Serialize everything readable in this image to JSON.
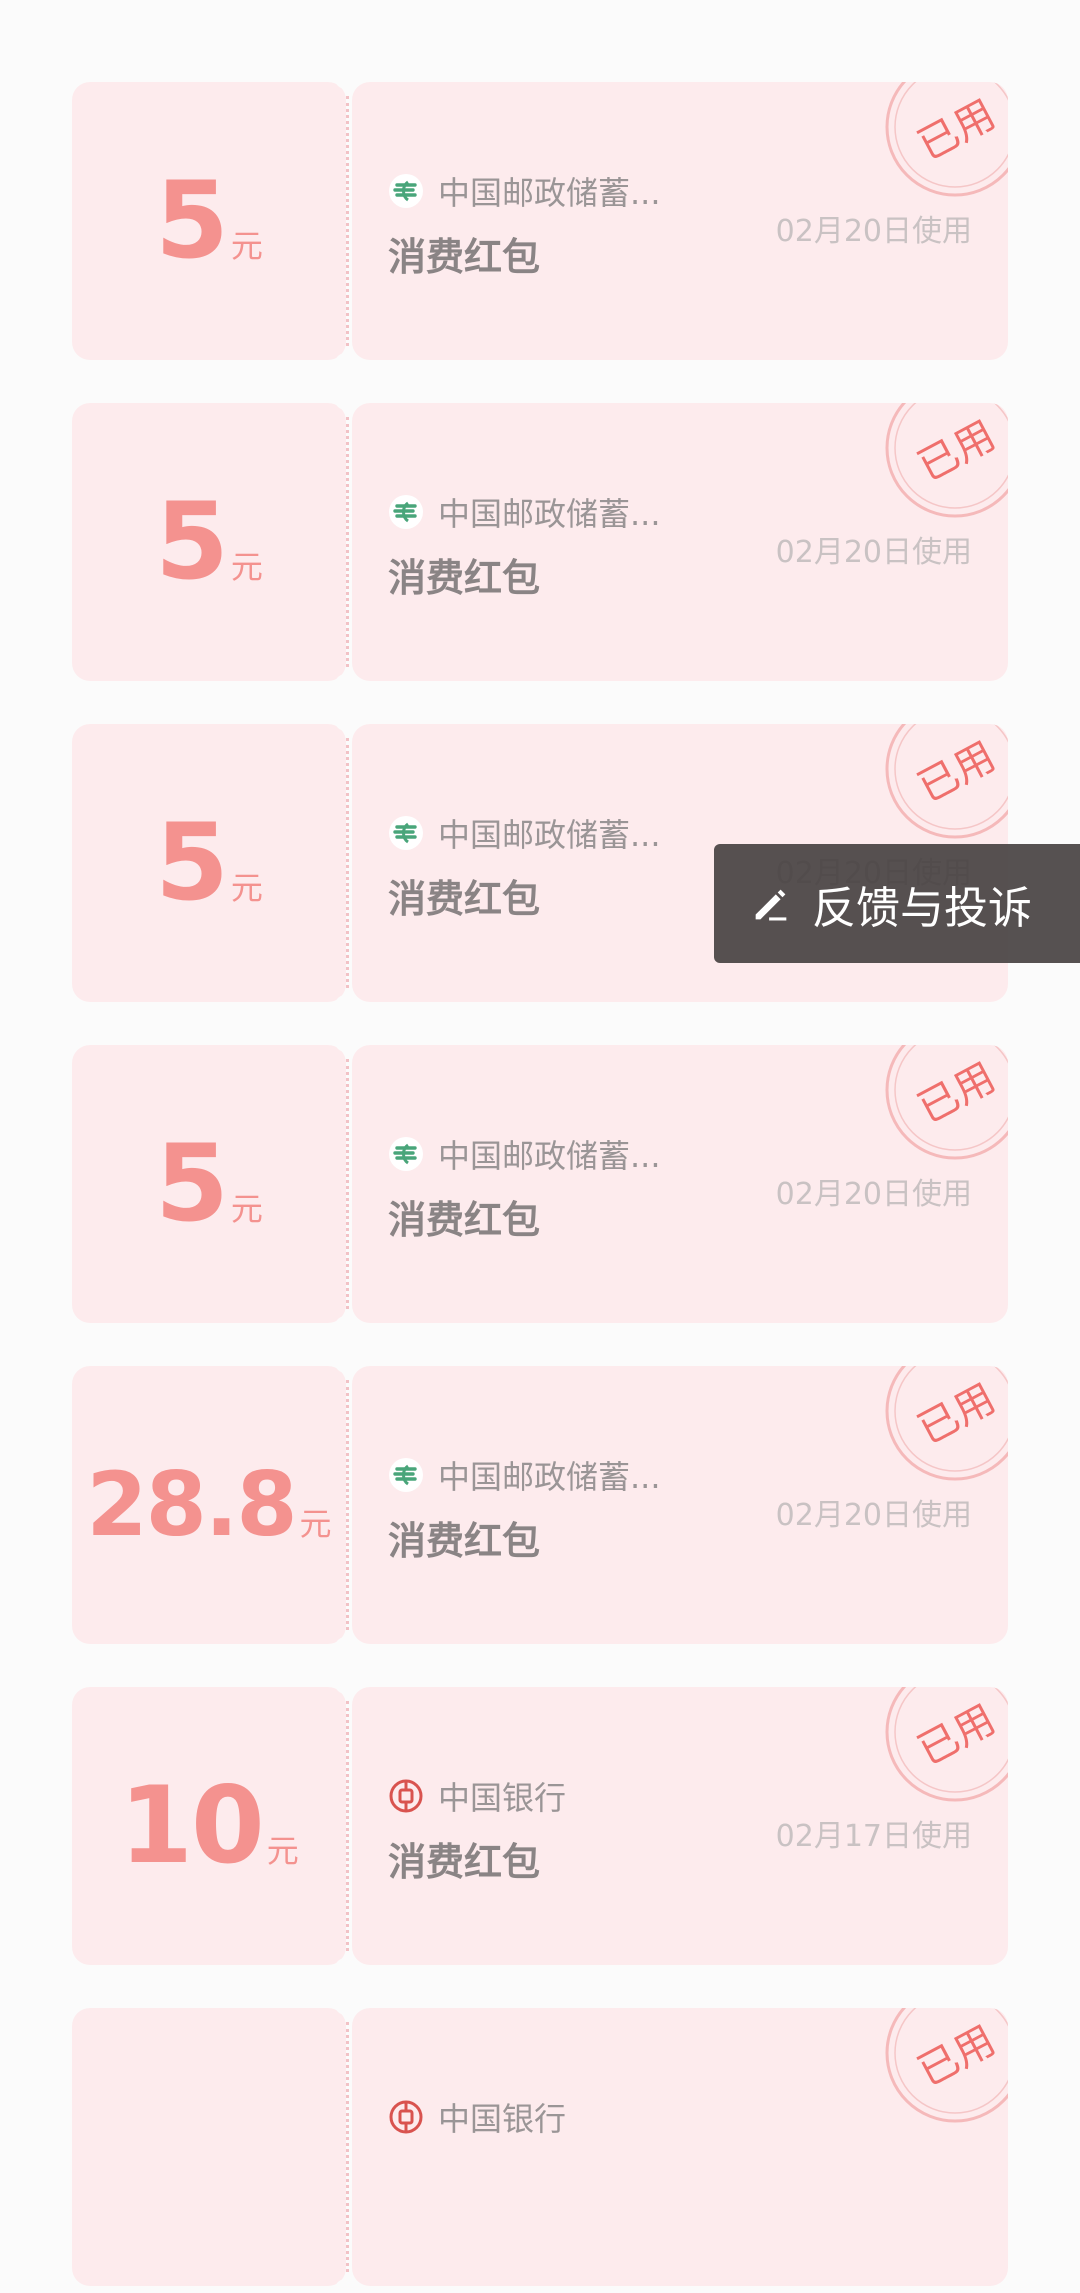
{
  "coupons": [
    {
      "amount": "5",
      "unit": "元",
      "bank": "中国邮政储蓄...",
      "bank_logo": "postal-savings-icon",
      "title": "消费红包",
      "date": "02月20日使用",
      "stamp": "已用"
    },
    {
      "amount": "5",
      "unit": "元",
      "bank": "中国邮政储蓄...",
      "bank_logo": "postal-savings-icon",
      "title": "消费红包",
      "date": "02月20日使用",
      "stamp": "已用"
    },
    {
      "amount": "5",
      "unit": "元",
      "bank": "中国邮政储蓄...",
      "bank_logo": "postal-savings-icon",
      "title": "消费红包",
      "date": "02月20日使用",
      "stamp": "已用"
    },
    {
      "amount": "5",
      "unit": "元",
      "bank": "中国邮政储蓄...",
      "bank_logo": "postal-savings-icon",
      "title": "消费红包",
      "date": "02月20日使用",
      "stamp": "已用"
    },
    {
      "amount": "28.8",
      "unit": "元",
      "bank": "中国邮政储蓄...",
      "bank_logo": "postal-savings-icon",
      "title": "消费红包",
      "date": "02月20日使用",
      "stamp": "已用"
    },
    {
      "amount": "10",
      "unit": "元",
      "bank": "中国银行",
      "bank_logo": "bank-of-china-icon",
      "title": "消费红包",
      "date": "02月17日使用",
      "stamp": "已用"
    },
    {
      "amount": "",
      "unit": "",
      "bank": "中国银行",
      "bank_logo": "bank-of-china-icon",
      "title": "",
      "date": "",
      "stamp": "已用"
    }
  ],
  "feedback_button": {
    "label": "反馈与投诉",
    "icon": "edit-pen-icon"
  },
  "colors": {
    "card_bg": "#fdebed",
    "amount": "#f4928f",
    "stamp": "#ef6f6c",
    "postal_green": "#49a57a",
    "boc_red": "#d9534f"
  }
}
